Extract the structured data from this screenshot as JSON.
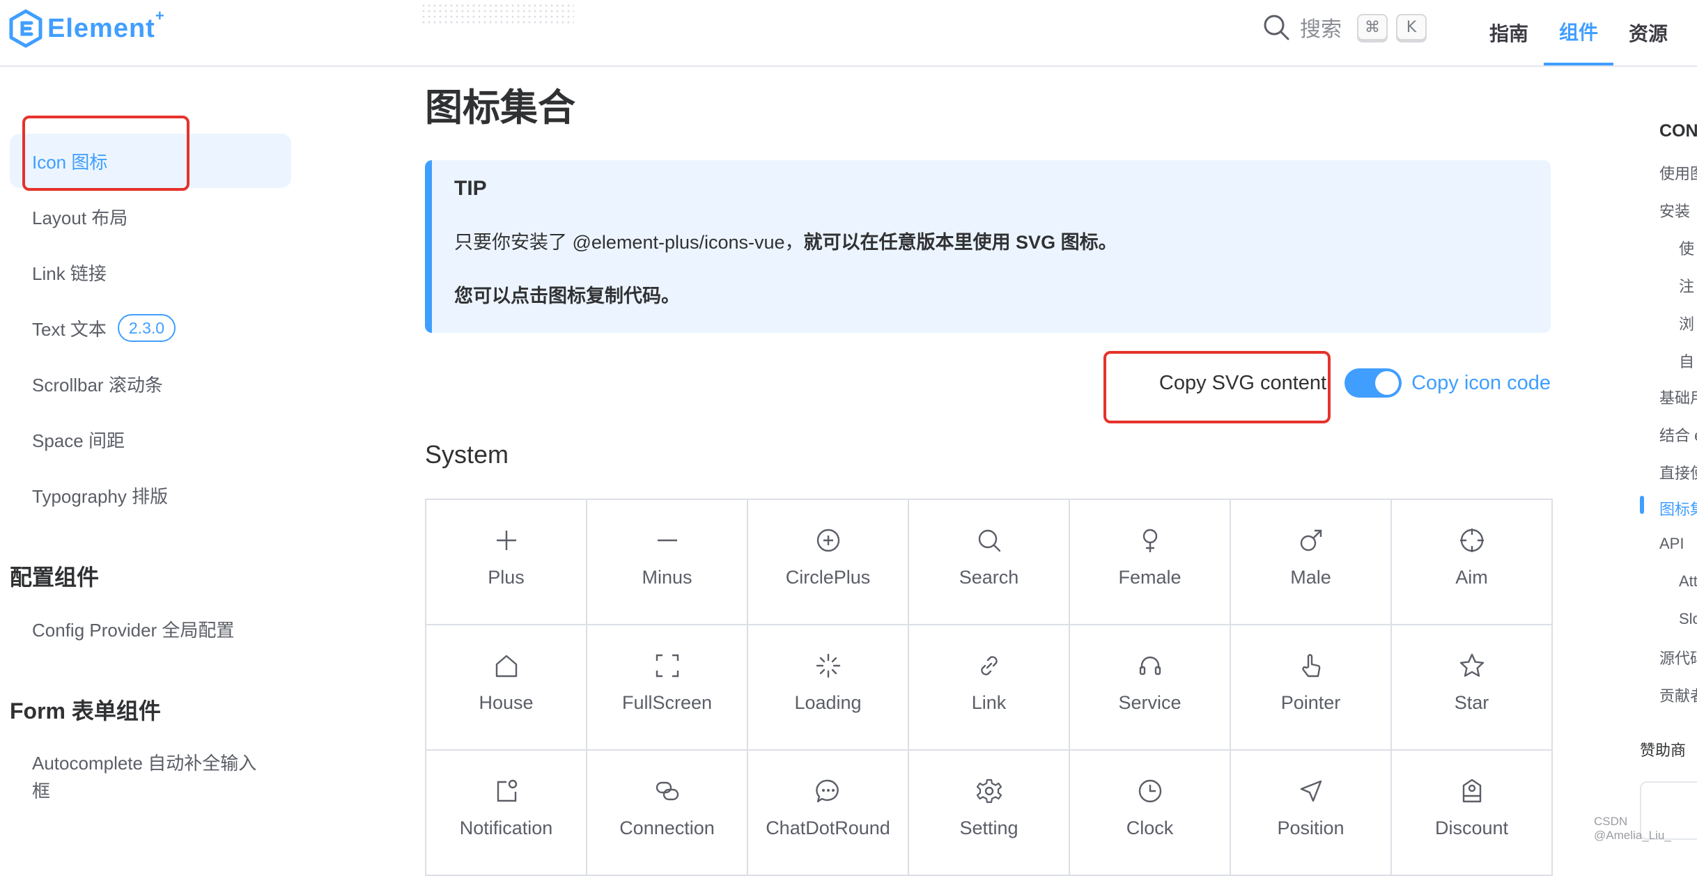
{
  "header": {
    "logo_text": "Element",
    "logo_plus": "+",
    "search_label": "搜索",
    "kbd_cmd": "⌘",
    "kbd_k": "K",
    "nav": [
      "指南",
      "组件",
      "资源"
    ]
  },
  "sidebar": {
    "items_top": [
      {
        "label": "Icon 图标",
        "active": true
      },
      {
        "label": "Layout 布局"
      },
      {
        "label": "Link 链接"
      },
      {
        "label": "Text 文本",
        "badge": "2.3.0"
      },
      {
        "label": "Scrollbar 滚动条"
      },
      {
        "label": "Space 间距"
      },
      {
        "label": "Typography 排版"
      }
    ],
    "group_config": "配置组件",
    "config_item": "Config Provider 全局配置",
    "group_form": "Form 表单组件",
    "form_item_line1": "Autocomplete 自动补全输入",
    "form_item_line2": "框"
  },
  "main": {
    "title": "图标集合",
    "tip": {
      "title": "TIP",
      "line1_plain": "只要你安装了 @element-plus/icons-vue，",
      "line1_bold": "就可以在任意版本里使用 SVG 图标。",
      "line2": "您可以点击图标复制代码。"
    },
    "copy_svg_label": "Copy SVG content",
    "copy_code_label": "Copy icon code",
    "toggle_on": true,
    "section_title": "System",
    "icons": [
      {
        "name": "Plus",
        "icon": "plus-icon"
      },
      {
        "name": "Minus",
        "icon": "minus-icon"
      },
      {
        "name": "CirclePlus",
        "icon": "circle-plus-icon"
      },
      {
        "name": "Search",
        "icon": "search-icon"
      },
      {
        "name": "Female",
        "icon": "female-icon"
      },
      {
        "name": "Male",
        "icon": "male-icon"
      },
      {
        "name": "Aim",
        "icon": "aim-icon"
      },
      {
        "name": "House",
        "icon": "house-icon"
      },
      {
        "name": "FullScreen",
        "icon": "fullscreen-icon"
      },
      {
        "name": "Loading",
        "icon": "loading-icon"
      },
      {
        "name": "Link",
        "icon": "link-icon"
      },
      {
        "name": "Service",
        "icon": "service-icon"
      },
      {
        "name": "Pointer",
        "icon": "pointer-icon"
      },
      {
        "name": "Star",
        "icon": "star-icon"
      },
      {
        "name": "Notification",
        "icon": "notification-icon"
      },
      {
        "name": "Connection",
        "icon": "connection-icon"
      },
      {
        "name": "ChatDotRound",
        "icon": "chat-dot-round-icon"
      },
      {
        "name": "Setting",
        "icon": "setting-icon"
      },
      {
        "name": "Clock",
        "icon": "clock-icon"
      },
      {
        "name": "Position",
        "icon": "position-icon"
      },
      {
        "name": "Discount",
        "icon": "discount-icon"
      }
    ]
  },
  "outline": {
    "head": "CON",
    "items": [
      {
        "label": "使用图"
      },
      {
        "label": "安装"
      },
      {
        "label": "使"
      },
      {
        "label": "注"
      },
      {
        "label": "浏"
      },
      {
        "label": "自"
      },
      {
        "label": "基础用"
      },
      {
        "label": "结合 e"
      },
      {
        "label": "直接使"
      },
      {
        "label": "图标集",
        "active": true
      },
      {
        "label": "API"
      },
      {
        "label": "Att"
      },
      {
        "label": "Slo"
      },
      {
        "label": "源代码"
      },
      {
        "label": "贡献者"
      }
    ],
    "sponsor_label": "赞助商"
  },
  "watermark": "CSDN @Amelia_Liu_",
  "colors": {
    "accent": "#409eff",
    "highlight_box": "#e6322c",
    "tip_bg": "#ecf5ff"
  }
}
